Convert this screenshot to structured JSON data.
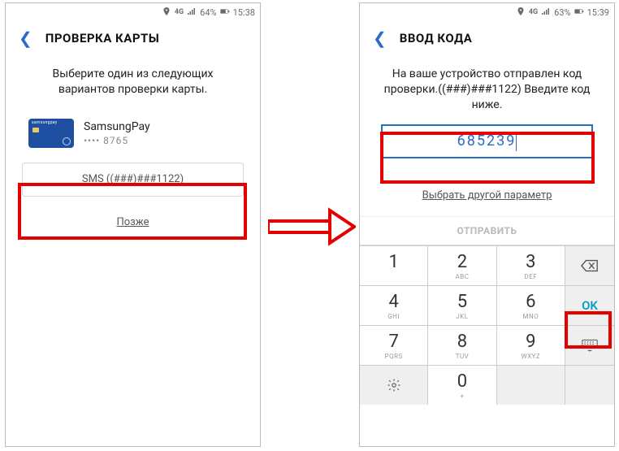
{
  "left": {
    "status": {
      "battery": "64%",
      "time": "15:38"
    },
    "header": {
      "title": "ПРОВЕРКА КАРТЫ"
    },
    "body_text": "Выберите один из следующих вариантов проверки карты.",
    "card": {
      "name": "SamsungPay",
      "mask": "•••• 8765",
      "brand": "samsungpay"
    },
    "sms_label": "SMS ((###)###1122)",
    "later_label": "Позже"
  },
  "right": {
    "status": {
      "battery": "63%",
      "time": "15:39"
    },
    "header": {
      "title": "ВВОД КОДА"
    },
    "body_text": "На ваше устройство отправлен код проверки.((###)###1122) Введите код ниже.",
    "code_value": "685239",
    "alt_param_label": "Выбрать другой параметр",
    "send_label": "ОТПРАВИТЬ",
    "keypad": {
      "k1": "1",
      "k2": "2",
      "k3": "3",
      "k4": "4",
      "k5": "5",
      "k6": "6",
      "k7": "7",
      "k8": "8",
      "k9": "9",
      "k0": "0",
      "sub2": "ABC",
      "sub3": "DEF",
      "sub4": "GHI",
      "sub5": "JKL",
      "sub6": "MNO",
      "sub7": "PQRS",
      "sub8": "TUV",
      "sub9": "WXYZ",
      "sub0": "+",
      "ok": "OK"
    }
  },
  "colors": {
    "accent": "#2a6cc4",
    "highlight": "#e50000"
  }
}
